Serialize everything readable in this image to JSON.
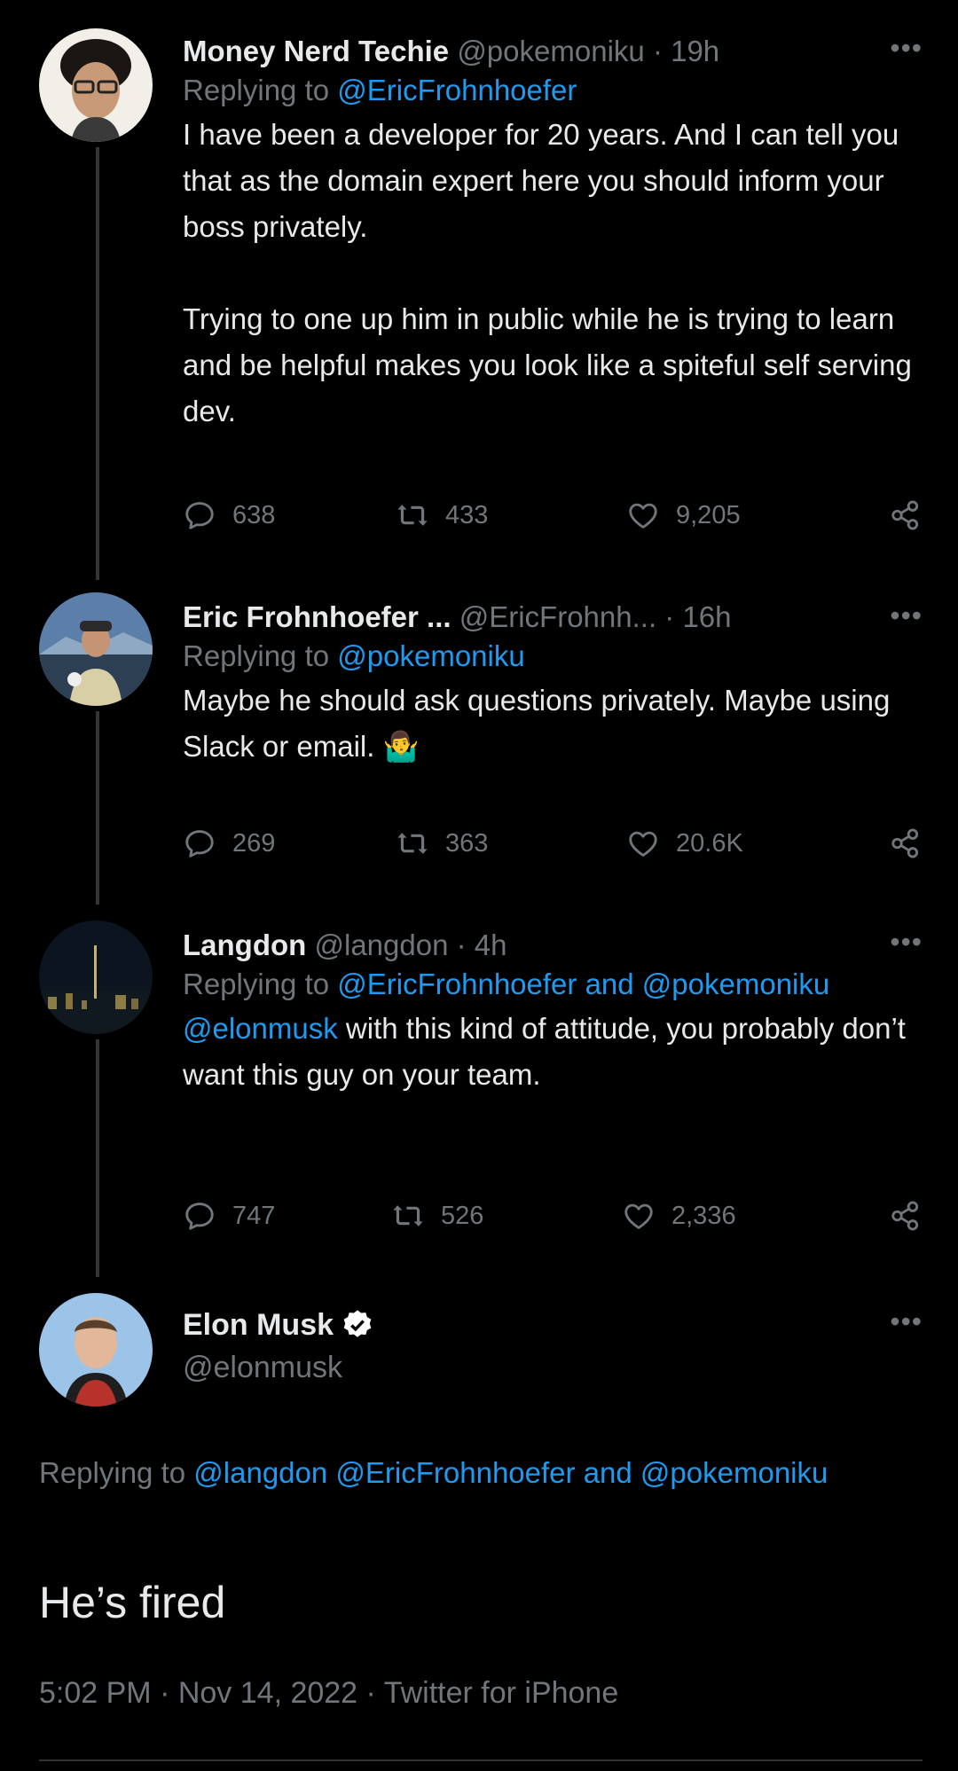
{
  "tweets": [
    {
      "name": "Money Nerd Techie",
      "handle": "@pokemoniku",
      "time": "· 19h",
      "replying_label": "Replying to",
      "replying_to": "@EricFrohnhoefer",
      "paragraph1": "I have been a developer for 20 years.  And I can tell you that as the domain expert here you should inform your boss privately.",
      "paragraph2": "Trying to one up him in public while he is trying to learn and be helpful makes you look like a spiteful self serving dev.",
      "replies": "638",
      "retweets": "433",
      "likes": "9,205"
    },
    {
      "name": "Eric Frohnhoefer ...",
      "handle": "@EricFrohnh...",
      "time": "· 16h",
      "replying_label": "Replying to",
      "replying_to": "@pokemoniku",
      "paragraph1": "Maybe he should ask questions privately. Maybe using Slack or email.",
      "emoji": "🤷‍♂️",
      "replies": "269",
      "retweets": "363",
      "likes": "20.6K"
    },
    {
      "name": "Langdon",
      "handle": "@langdon",
      "time": "· 4h",
      "replying_label": "Replying to",
      "replying_to_1": "@EricFrohnhoefer",
      "and": "and",
      "replying_to_2": "@pokemoniku",
      "mention": "@elonmusk",
      "paragraph1": "with this kind of attitude, you probably don’t want this guy on your team.",
      "replies": "747",
      "retweets": "526",
      "likes": "2,336"
    }
  ],
  "main_tweet": {
    "name": "Elon Musk",
    "handle": "@elonmusk",
    "replying_label": "Replying to",
    "replying_to_1": "@langdon",
    "replying_to_2": "@EricFrohnhoefer",
    "and": "and",
    "replying_to_3": "@pokemoniku",
    "text": "He’s fired",
    "meta": "5:02 PM · Nov 14, 2022 · Twitter for iPhone"
  },
  "colors": {
    "background": "#000000",
    "text": "#e7e9ea",
    "muted": "#71767b",
    "link": "#1d9bf0",
    "verified": "#ffffff"
  },
  "icons": [
    "reply-icon",
    "retweet-icon",
    "like-icon",
    "share-icon",
    "more-icon",
    "verified-badge-icon"
  ]
}
